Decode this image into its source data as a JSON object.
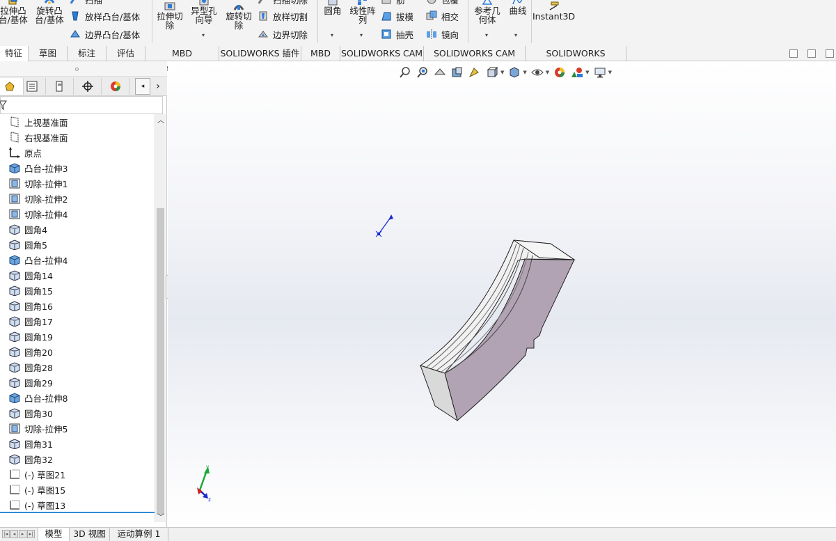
{
  "ribbon": {
    "extrude_boss": "拉伸凸\n台/基体",
    "revolve_boss": "旋转凸\n台/基体",
    "sweep_boss": "扫描",
    "loft_boss": "放样凸台/基体",
    "boundary_boss": "边界凸台/基体",
    "extrude_cut": "拉伸切\n除",
    "hole_wizard": "异型孔\n向导",
    "revolve_cut": "旋转切\n除",
    "sweep_cut": "扫描切除",
    "loft_cut": "放样切割",
    "boundary_cut": "边界切除",
    "fillet": "圆角",
    "linear_pattern": "线性阵\n列",
    "rib": "筋",
    "draft": "拔模",
    "shell": "抽壳",
    "wrap": "包覆",
    "intersect": "相交",
    "mirror": "镜向",
    "ref_geometry": "参考几\n何体",
    "curves": "曲线",
    "instant3d": "Instant3D"
  },
  "command_tabs": [
    {
      "label": "特征",
      "active": true
    },
    {
      "label": "草图",
      "active": false
    },
    {
      "label": "标注",
      "active": false
    },
    {
      "label": "评估",
      "active": false
    },
    {
      "label": "MBD Dimensions",
      "active": false
    },
    {
      "label": "SOLIDWORKS 插件",
      "active": false
    },
    {
      "label": "MBD",
      "active": false
    },
    {
      "label": "SOLIDWORKS CAM",
      "active": false
    },
    {
      "label": "SOLIDWORKS CAM TBM",
      "active": false
    },
    {
      "label": "SOLIDWORKS Inspection",
      "active": false
    }
  ],
  "manager_tabs": [
    "feature-manager",
    "property-manager",
    "configuration-manager",
    "dimxpert-manager",
    "display-manager"
  ],
  "feature_tree": [
    {
      "label": "上视基准面",
      "icon": "plane-icon"
    },
    {
      "label": "右视基准面",
      "icon": "plane-icon"
    },
    {
      "label": "原点",
      "icon": "origin-icon"
    },
    {
      "label": "凸台-拉伸3",
      "icon": "boss-extrude-icon"
    },
    {
      "label": "切除-拉伸1",
      "icon": "cut-extrude-icon"
    },
    {
      "label": "切除-拉伸2",
      "icon": "cut-extrude-icon"
    },
    {
      "label": "切除-拉伸4",
      "icon": "cut-extrude-icon"
    },
    {
      "label": "圆角4",
      "icon": "fillet-icon"
    },
    {
      "label": "圆角5",
      "icon": "fillet-icon"
    },
    {
      "label": "凸台-拉伸4",
      "icon": "boss-extrude-icon"
    },
    {
      "label": "圆角14",
      "icon": "fillet-icon"
    },
    {
      "label": "圆角15",
      "icon": "fillet-icon"
    },
    {
      "label": "圆角16",
      "icon": "fillet-icon"
    },
    {
      "label": "圆角17",
      "icon": "fillet-icon"
    },
    {
      "label": "圆角19",
      "icon": "fillet-icon"
    },
    {
      "label": "圆角20",
      "icon": "fillet-icon"
    },
    {
      "label": "圆角28",
      "icon": "fillet-icon"
    },
    {
      "label": "圆角29",
      "icon": "fillet-icon"
    },
    {
      "label": "凸台-拉伸8",
      "icon": "boss-extrude-icon"
    },
    {
      "label": "圆角30",
      "icon": "fillet-icon"
    },
    {
      "label": "切除-拉伸5",
      "icon": "cut-extrude-icon"
    },
    {
      "label": "圆角31",
      "icon": "fillet-icon"
    },
    {
      "label": "圆角32",
      "icon": "fillet-icon"
    },
    {
      "label": "(-) 草图21",
      "icon": "sketch-icon"
    },
    {
      "label": "(-) 草图15",
      "icon": "sketch-icon"
    },
    {
      "label": "(-) 草图13",
      "icon": "sketch-icon"
    }
  ],
  "bottom_tabs": [
    {
      "label": "模型",
      "active": true
    },
    {
      "label": "3D 视图",
      "active": false
    },
    {
      "label": "运动算例 1",
      "active": false
    }
  ],
  "triad": {
    "x": "x",
    "y": "y",
    "z": "z"
  },
  "colors": {
    "accent": "#2e8bd6",
    "ribbon_bg": "#f3f3f3",
    "part_side": "#b1a2b3",
    "part_top": "#f2f2f2",
    "part_end": "#dcdcdc"
  }
}
